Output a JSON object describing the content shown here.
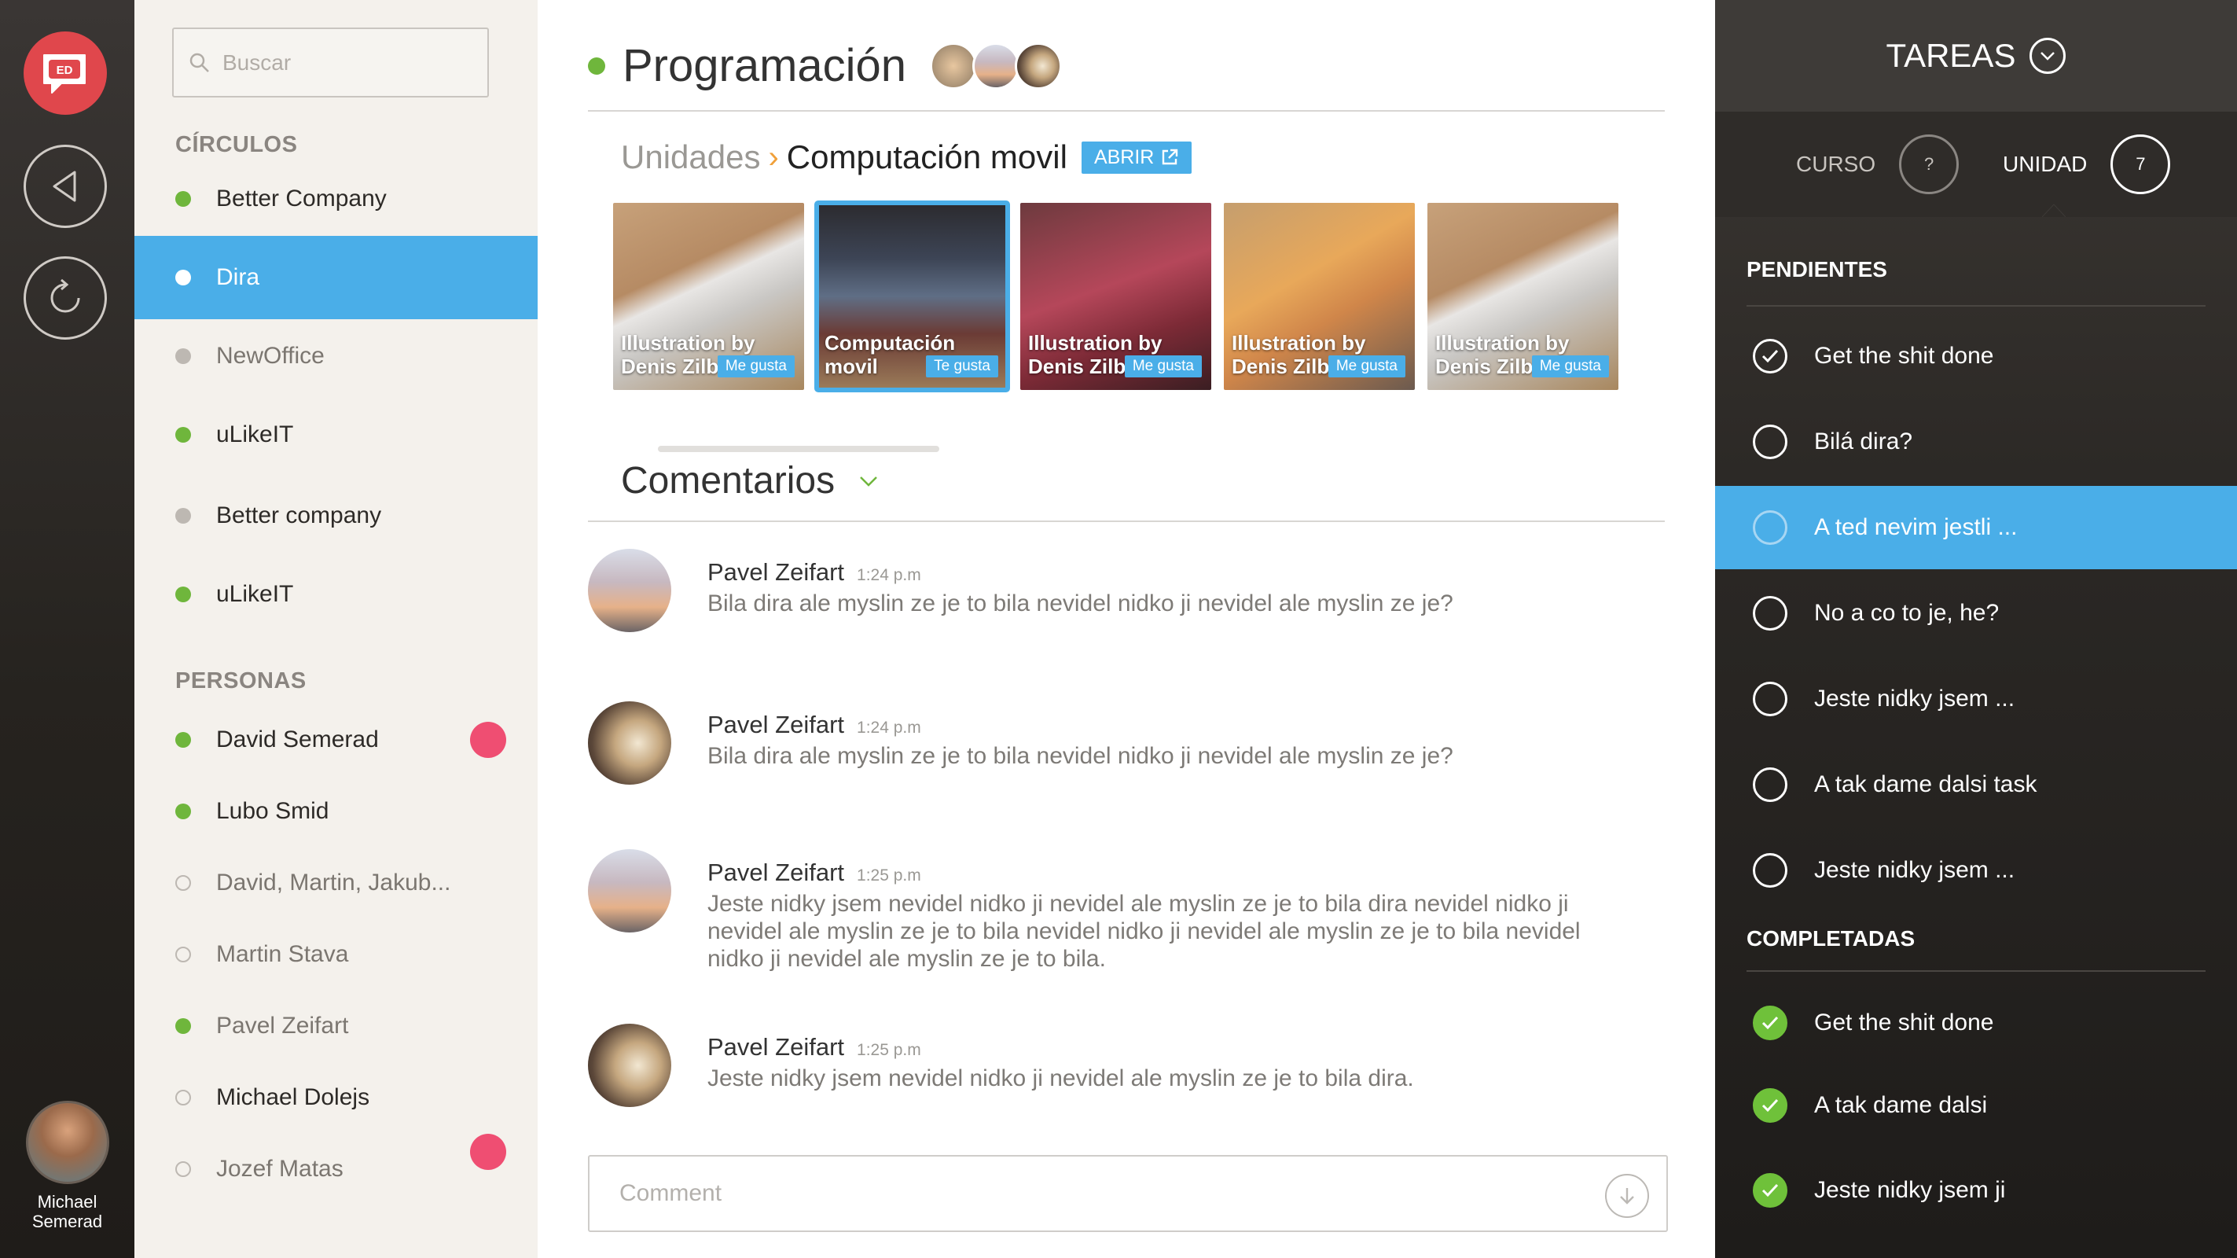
{
  "user": {
    "name_line1": "Michael",
    "name_line2": "Semerad"
  },
  "logo": {
    "text": "ED"
  },
  "search": {
    "placeholder": "Buscar"
  },
  "sidebar": {
    "circles_title": "CÍRCULOS",
    "circles": [
      {
        "label": "Better Company",
        "status": "online"
      },
      {
        "label": "Dira",
        "status": "selected"
      },
      {
        "label": "NewOffice",
        "status": "away"
      },
      {
        "label": "uLikeIT",
        "status": "online"
      },
      {
        "label": "Better company",
        "status": "away"
      },
      {
        "label": "uLikeIT",
        "status": "online"
      }
    ],
    "people_title": "PERSONAS",
    "people": [
      {
        "label": "David Semerad",
        "status": "online",
        "badge": true
      },
      {
        "label": "Lubo Smid",
        "status": "online"
      },
      {
        "label": "David, Martin, Jakub...",
        "status": "offline"
      },
      {
        "label": "Martin Stava",
        "status": "offline"
      },
      {
        "label": "Pavel Zeifart",
        "status": "online"
      },
      {
        "label": "Michael Dolejs",
        "status": "offline"
      },
      {
        "label": "Jozef Matas",
        "status": "offline",
        "badge": true
      }
    ]
  },
  "main": {
    "title": "Programación",
    "breadcrumb": {
      "parent": "Unidades",
      "separator": "›",
      "current": "Computación movil",
      "open_label": "ABRIR"
    },
    "units": [
      {
        "line1": "Illustration by",
        "line2": "Denis Zilber",
        "like": "Me gusta"
      },
      {
        "line1": "Computación",
        "line2": "movil",
        "like": "Te gusta",
        "selected": true
      },
      {
        "line1": "Illustration by",
        "line2": "Denis Zilber",
        "like": "Me gusta"
      },
      {
        "line1": "Illustration by",
        "line2": "Denis Zilber",
        "like": "Me gusta"
      },
      {
        "line1": "Illustration by",
        "line2": "Denis Zilber",
        "like": "Me gusta"
      }
    ],
    "comments_title": "Comentarios",
    "comments": [
      {
        "author": "Pavel Zeifart",
        "time": "1:24 p.m",
        "text": "Bila dira ale myslin ze je to bila nevidel nidko ji nevidel ale myslin ze je?"
      },
      {
        "author": "Pavel Zeifart",
        "time": "1:24 p.m",
        "text": "Bila dira ale myslin ze je to bila nevidel nidko ji nevidel ale myslin ze je?"
      },
      {
        "author": "Pavel Zeifart",
        "time": "1:25 p.m",
        "text": "Jeste nidky jsem nevidel nidko ji nevidel ale myslin ze je to bila dira nevidel nidko ji nevidel ale myslin ze je to bila nevidel nidko ji nevidel ale myslin ze je to bila nevidel nidko ji nevidel ale myslin ze je to bila."
      },
      {
        "author": "Pavel Zeifart",
        "time": "1:25 p.m",
        "text": "Jeste nidky jsem nevidel nidko ji nevidel ale myslin ze je to bila dira."
      }
    ],
    "comment_placeholder": "Comment"
  },
  "tasks": {
    "title": "TAREAS",
    "tab_course": "CURSO",
    "tab_course_count": "?",
    "tab_unit": "UNIDAD",
    "tab_unit_count": "7",
    "pending_title": "PENDIENTES",
    "pending": [
      {
        "label": "Get the shit done",
        "checked": true
      },
      {
        "label": "Bilá dira?"
      },
      {
        "label": "A ted nevim jestli ...",
        "selected": true
      },
      {
        "label": "No a co to je, he?"
      },
      {
        "label": "Jeste nidky jsem ..."
      },
      {
        "label": "A tak dame dalsi task"
      },
      {
        "label": "Jeste nidky jsem ..."
      }
    ],
    "done_title": "COMPLETADAS",
    "done": [
      {
        "label": "Get the shit done"
      },
      {
        "label": "A tak dame dalsi"
      },
      {
        "label": "Jeste nidky jsem ji"
      }
    ]
  },
  "colors": {
    "accent": "#4aaee8",
    "online": "#6fb63c",
    "badge": "#ef4e72",
    "logo": "#e0474c",
    "done": "#6fc13a"
  }
}
